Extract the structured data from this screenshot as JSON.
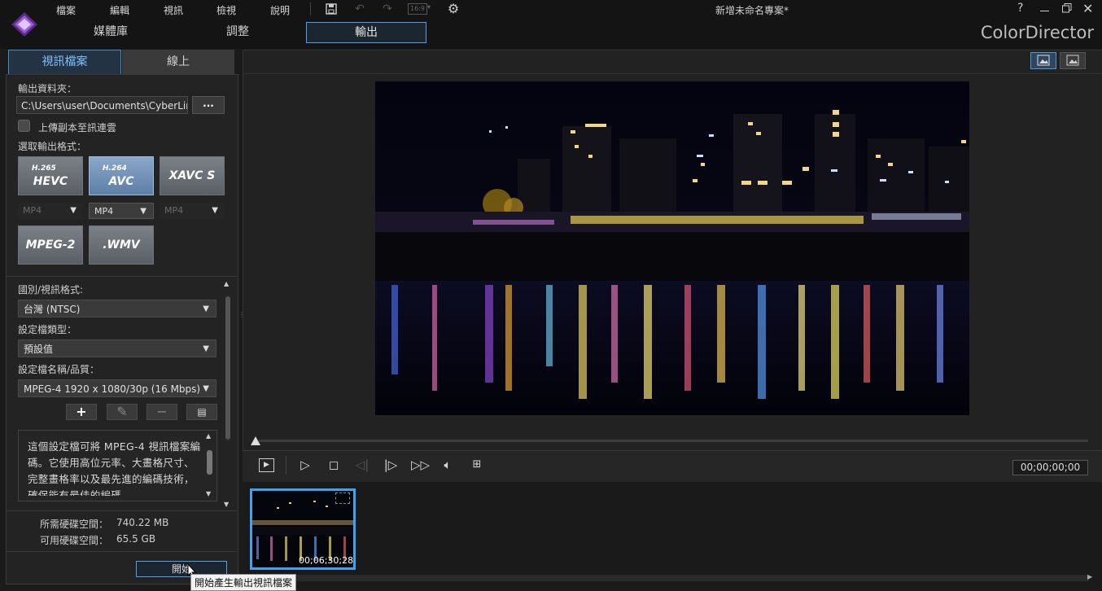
{
  "menubar": {
    "items": [
      "檔案",
      "編輯",
      "視訊",
      "檢視",
      "說明"
    ],
    "aspect_ratio": "16:9",
    "project_title": "新增未命名專案*",
    "help": "?"
  },
  "main_tabs": {
    "library": "媒體庫",
    "adjust": "調整",
    "output": "輸出"
  },
  "app_name": "ColorDirector",
  "left_tabs": {
    "video_file": "視訊檔案",
    "online": "線上"
  },
  "output_folder": {
    "label": "輸出資料夾：",
    "path": "C:\\Users\\user\\Documents\\CyberLink...",
    "browse": "..."
  },
  "upload_copy": {
    "label": "上傳副本至訊連雲",
    "checked": false
  },
  "format_section": {
    "label": "選取輸出格式：",
    "formats": [
      {
        "small": "H.265",
        "big": "HEVC",
        "container": "MP4",
        "selected": false
      },
      {
        "small": "H.264",
        "big": "AVC",
        "container": "MP4",
        "selected": true
      },
      {
        "small": "",
        "big": "XAVC S",
        "container": "MP4",
        "selected": false
      },
      {
        "small": "",
        "big": "MPEG-2",
        "container": "",
        "selected": false
      },
      {
        "small": "",
        "big": ".WMV",
        "container": "",
        "selected": false
      }
    ]
  },
  "region": {
    "label": "國別/視訊格式:",
    "value": "台灣 (NTSC)"
  },
  "profile_type": {
    "label": "設定檔類型：",
    "value": "預設值"
  },
  "profile_name": {
    "label": "設定檔名稱/品質：",
    "value": "MPEG-4 1920 x 1080/30p (16 Mbps)"
  },
  "description": "這個設定檔可將 MPEG-4 視訊檔案編碼。它使用高位元率、大畫格尺寸、完整畫格率以及最先進的編碼技術，確保能有最佳的編碼",
  "disk": {
    "required_label": "所需硬碟空間：",
    "required_value": "740.22 MB",
    "available_label": "可用硬碟空間：",
    "available_value": "65.5 GB"
  },
  "start_button": "開始",
  "tooltip": "開始產生輸出視訊檔案",
  "timecode": "00;00;00;00",
  "clip": {
    "duration": "00;06;30;28"
  },
  "colors": {
    "accent": "#3da3f0",
    "tab_text": "#7fc3ff"
  }
}
